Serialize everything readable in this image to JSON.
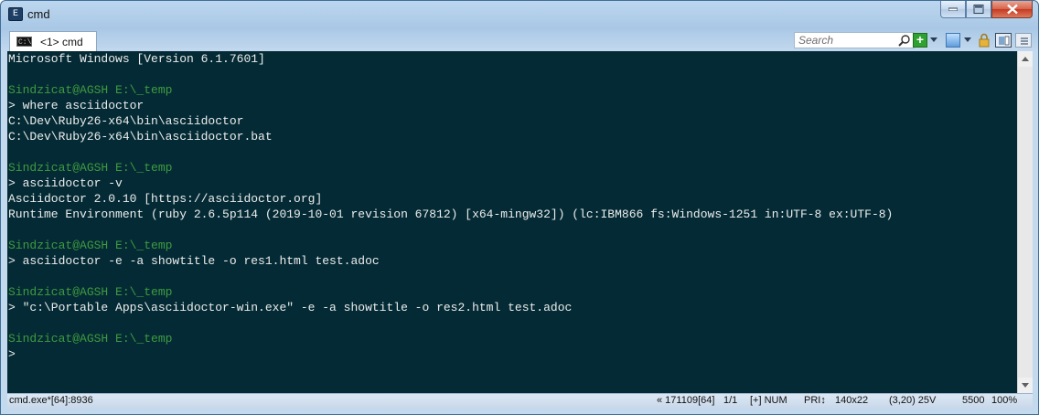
{
  "window": {
    "title": "cmd",
    "app_icon_glyph": "E",
    "controls": [
      "minimize-icon",
      "maximize-icon",
      "close-icon"
    ]
  },
  "tabs": [
    {
      "label": "<1> cmd",
      "icon": "console-icon",
      "icon_glyph": "C:\\"
    }
  ],
  "toolbar": {
    "search_placeholder": "Search",
    "search_icon": "search-icon",
    "new_console_glyph": "+",
    "buttons": [
      "new-console-icon",
      "windows-icon",
      "lock-icon",
      "panel-icon",
      "more-icon"
    ]
  },
  "colors": {
    "console_bg": "#042b35",
    "console_fg": "#ececec",
    "prompt_fg": "#3f9a3f",
    "accent": "#2ea131"
  },
  "console": {
    "lines": [
      {
        "text": "Microsoft Windows [Version 6.1.7601]",
        "kind": "output"
      },
      {
        "text": "",
        "kind": "output"
      },
      {
        "text": "Sindzicat@AGSH E:\\_temp",
        "kind": "prompt"
      },
      {
        "text": "> where asciidoctor",
        "kind": "output"
      },
      {
        "text": "C:\\Dev\\Ruby26-x64\\bin\\asciidoctor",
        "kind": "output"
      },
      {
        "text": "C:\\Dev\\Ruby26-x64\\bin\\asciidoctor.bat",
        "kind": "output"
      },
      {
        "text": "",
        "kind": "output"
      },
      {
        "text": "Sindzicat@AGSH E:\\_temp",
        "kind": "prompt"
      },
      {
        "text": "> asciidoctor -v",
        "kind": "output"
      },
      {
        "text": "Asciidoctor 2.0.10 [https://asciidoctor.org]",
        "kind": "output"
      },
      {
        "text": "Runtime Environment (ruby 2.6.5p114 (2019-10-01 revision 67812) [x64-mingw32]) (lc:IBM866 fs:Windows-1251 in:UTF-8 ex:UTF-8)",
        "kind": "output"
      },
      {
        "text": "",
        "kind": "output"
      },
      {
        "text": "Sindzicat@AGSH E:\\_temp",
        "kind": "prompt"
      },
      {
        "text": "> asciidoctor -e -a showtitle -o res1.html test.adoc",
        "kind": "output"
      },
      {
        "text": "",
        "kind": "output"
      },
      {
        "text": "Sindzicat@AGSH E:\\_temp",
        "kind": "prompt"
      },
      {
        "text": "> \"c:\\Portable Apps\\asciidoctor-win.exe\" -e -a showtitle -o res2.html test.adoc",
        "kind": "output"
      },
      {
        "text": "",
        "kind": "output"
      },
      {
        "text": "Sindzicat@AGSH E:\\_temp",
        "kind": "prompt"
      },
      {
        "text": ">",
        "kind": "output"
      }
    ]
  },
  "status": {
    "process": "cmd.exe*[64]:8936",
    "position": "« 171109[64]",
    "tab_index": "1/1",
    "keys": "[+] NUM",
    "priority": "PRI↕",
    "size": "140x22",
    "cursor": "(3,20) 25V",
    "count": "5500",
    "zoom": "100%"
  }
}
